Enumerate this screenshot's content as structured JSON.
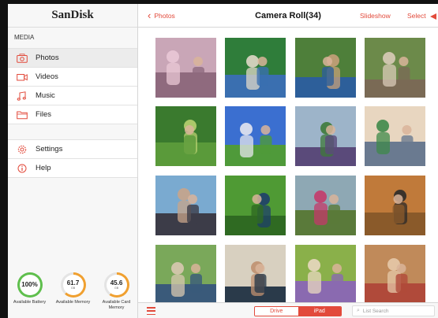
{
  "sidebar": {
    "brand": "SanDisk",
    "section": "MEDIA",
    "items": [
      {
        "label": "Photos",
        "icon": "camera-icon",
        "active": true
      },
      {
        "label": "Videos",
        "icon": "video-icon",
        "active": false
      },
      {
        "label": "Music",
        "icon": "music-icon",
        "active": false
      },
      {
        "label": "Files",
        "icon": "folder-icon",
        "active": false
      }
    ],
    "items2": [
      {
        "label": "Settings",
        "icon": "gear-icon"
      },
      {
        "label": "Help",
        "icon": "info-icon"
      }
    ],
    "gauges": [
      {
        "value": "100%",
        "unit": "",
        "label": "Available Battery",
        "fraction": 1.0,
        "color": "#5fbf4d"
      },
      {
        "value": "61.7",
        "unit": "GB",
        "label": "Available Memory",
        "fraction": 0.62,
        "color": "#f0a030"
      },
      {
        "value": "45.6",
        "unit": "GB",
        "label": "Available Card Memory",
        "fraction": 0.6,
        "color": "#f0a030"
      }
    ]
  },
  "header": {
    "back_label": "Photos",
    "title": "Camera Roll(34)",
    "slideshow_label": "Slideshow",
    "select_label": "Select"
  },
  "photos": [
    {
      "name": "photo-blossoms",
      "sky": "#c9a6b7",
      "ground": "#8f6a7e",
      "accent": "#e9c8d6"
    },
    {
      "name": "photo-students-laptop",
      "sky": "#2f7d3a",
      "ground": "#3a6fb0",
      "accent": "#e0d8c8"
    },
    {
      "name": "photo-man-reading",
      "sky": "#4e7f3a",
      "ground": "#2d5f9a",
      "accent": "#c7a07a"
    },
    {
      "name": "photo-woman-laptop-bench",
      "sky": "#6c8a4a",
      "ground": "#7a6a55",
      "accent": "#d9cbb8"
    },
    {
      "name": "photo-group-lawn",
      "sky": "#3a7a2e",
      "ground": "#5a9a3a",
      "accent": "#b8d070"
    },
    {
      "name": "photo-man-grass-sky",
      "sky": "#3b6fd0",
      "ground": "#4f9a3a",
      "accent": "#e6e6ee"
    },
    {
      "name": "photo-woman-tablet-tree",
      "sky": "#9db4c9",
      "ground": "#5a4a7a",
      "accent": "#3f7a3a"
    },
    {
      "name": "photo-library-woman",
      "sky": "#e8d6c0",
      "ground": "#6a7a90",
      "accent": "#3f8a4a"
    },
    {
      "name": "photo-friends-camera",
      "sky": "#7aaad0",
      "ground": "#3c3c48",
      "accent": "#c8a48a"
    },
    {
      "name": "photo-man-grass-field",
      "sky": "#4f9a34",
      "ground": "#2f6a22",
      "accent": "#1e3f6a"
    },
    {
      "name": "photo-woman-park",
      "sky": "#8ea8b4",
      "ground": "#5a7a3a",
      "accent": "#c43a6a"
    },
    {
      "name": "photo-man-desk",
      "sky": "#c07a3a",
      "ground": "#8a5a2a",
      "accent": "#2a2a2a"
    },
    {
      "name": "photo-students-trees",
      "sky": "#7aa85a",
      "ground": "#3a5a7a",
      "accent": "#d8c8b0"
    },
    {
      "name": "photo-man-portrait",
      "sky": "#d8d0c0",
      "ground": "#2a3a4a",
      "accent": "#c09070"
    },
    {
      "name": "photo-group-bench",
      "sky": "#8ab04a",
      "ground": "#8a6ab0",
      "accent": "#e8d8c0"
    },
    {
      "name": "photo-woman-desk",
      "sky": "#c08a5a",
      "ground": "#b04a3a",
      "accent": "#e6c8a8"
    }
  ],
  "bottombar": {
    "drive_label": "Drive",
    "ipad_label": "iPad",
    "search_placeholder": "List Search"
  },
  "colors": {
    "accent": "#e24a3b"
  }
}
